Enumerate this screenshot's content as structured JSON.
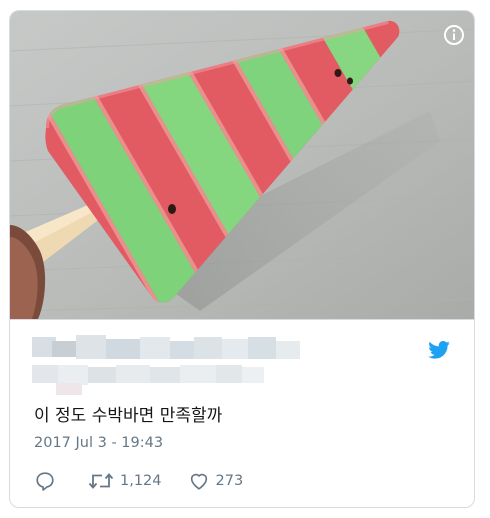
{
  "tweet": {
    "text": "이 정도 수박바면 만족할까",
    "timestamp": "2017 Jul 3 - 19:43",
    "actions": {
      "reply_icon": "reply-icon",
      "retweet_icon": "retweet-icon",
      "retweet_count": "1,124",
      "like_icon": "heart-icon",
      "like_count": "273"
    },
    "media": {
      "description_icon": "info-icon"
    },
    "brand": {
      "icon": "twitter-bird-icon",
      "color": "#1da1f2"
    }
  },
  "colors": {
    "text": "#14171a",
    "muted": "#657786",
    "border": "#d5dde3"
  }
}
